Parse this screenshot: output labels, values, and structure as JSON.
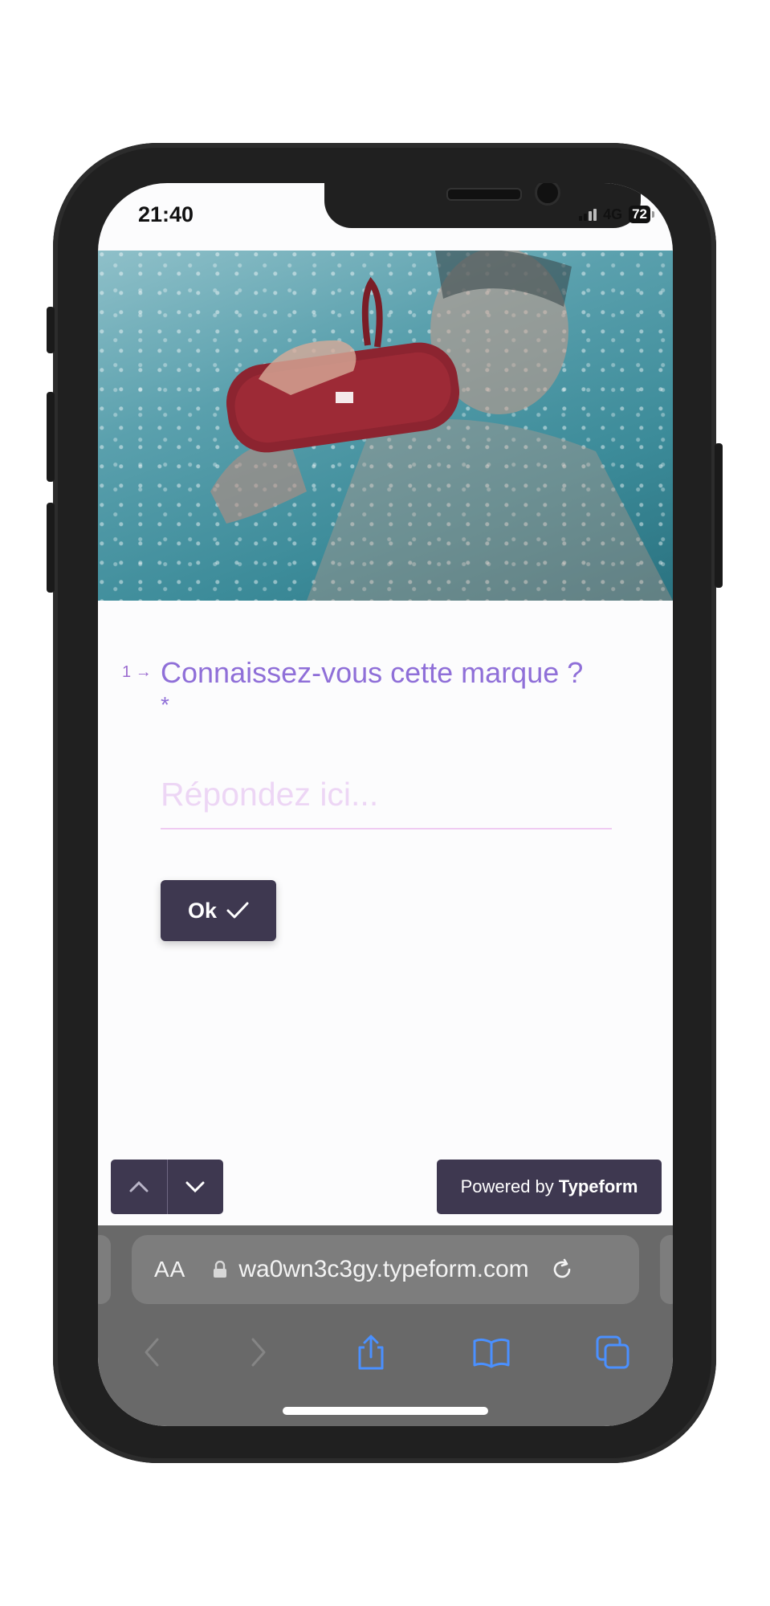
{
  "status_bar": {
    "time": "21:40",
    "network": "4G",
    "battery": "72"
  },
  "question": {
    "number": "1",
    "title": "Connaissez-vous cette marque ?",
    "required_mark": "*",
    "placeholder": "Répondez ici...",
    "answer_value": ""
  },
  "actions": {
    "ok_label": "Ok"
  },
  "footer": {
    "powered_by": "Powered by",
    "brand": "Typeform"
  },
  "browser": {
    "text_size_label": "AA",
    "url": "wa0wn3c3gy.typeform.com"
  },
  "colors": {
    "accent": "#8f6fd8",
    "button_bg": "#3e3850",
    "browser_bg": "#696969",
    "toolbar_icon": "#4a90ff"
  }
}
